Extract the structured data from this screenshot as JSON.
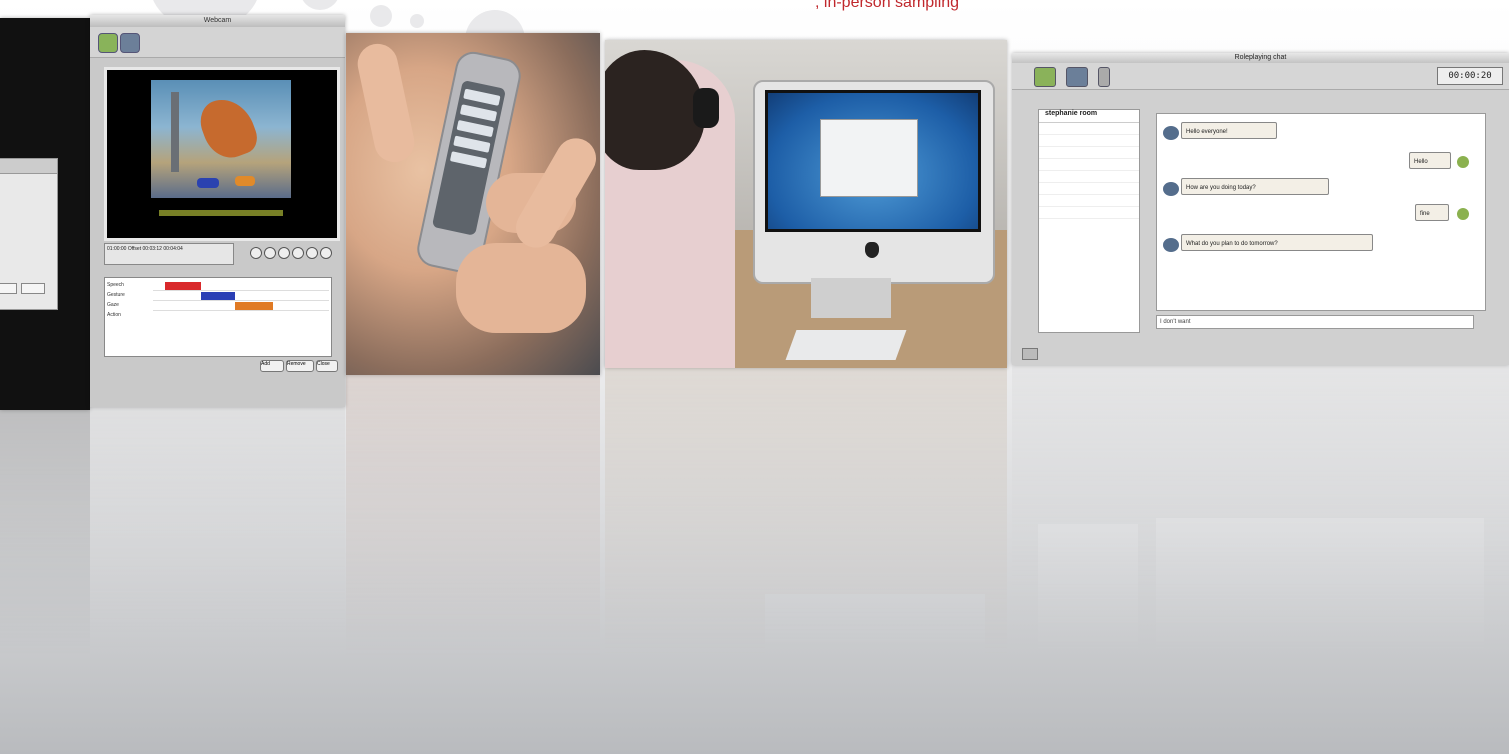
{
  "caption": {
    "text": ", in-person sampling"
  },
  "panel_b": {
    "window_title": "Webcam",
    "time_readout": "01:00:00 Offset 00:03:12 00:04:04",
    "tracks": [
      "Speech",
      "Gesture",
      "Gaze",
      "Action"
    ],
    "buttons": [
      "Add",
      "Remove",
      "Close"
    ]
  },
  "panel_e": {
    "window_title": "Roleplaying chat",
    "clock": "00:00:20",
    "room_header": "stephanie room",
    "messages_left": [
      "Hello everyone!",
      "How are you doing today?",
      "What do you plan to do tomorrow?"
    ],
    "messages_right": [
      "Hello",
      "fine"
    ],
    "send_placeholder": "I don't want"
  },
  "colors": {
    "caption": "#c0282d",
    "panel_dark": "#111111",
    "icon_green": "#8ab25a"
  }
}
